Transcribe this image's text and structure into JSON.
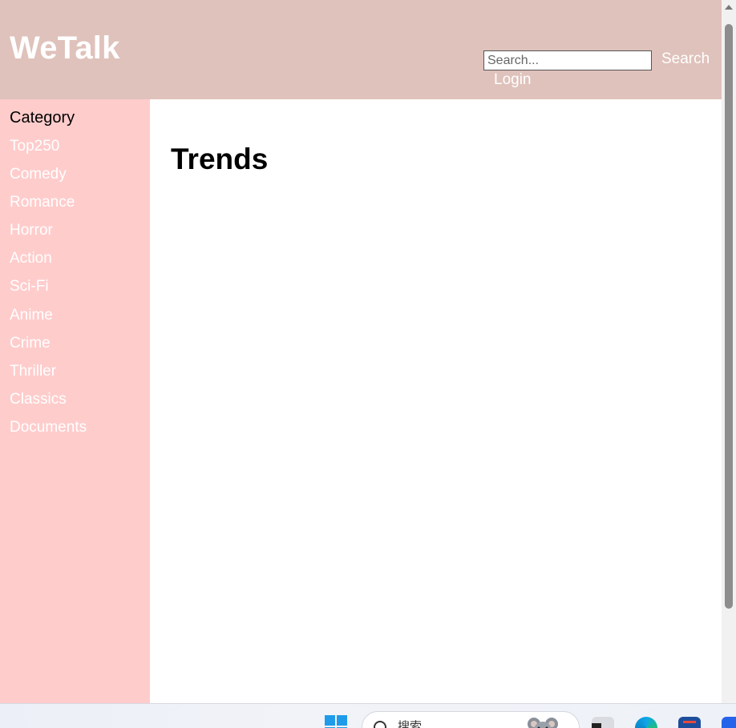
{
  "header": {
    "logo": "WeTalk",
    "search_placeholder": "Search...",
    "search_label": "Search",
    "login_label": "Login"
  },
  "sidebar": {
    "title": "Category",
    "items": [
      "Top250",
      "Comedy",
      "Romance",
      "Horror",
      "Action",
      "Sci-Fi",
      "Anime",
      "Crime",
      "Thriller",
      "Classics",
      "Documents"
    ]
  },
  "main": {
    "title": "Trends"
  },
  "taskbar": {
    "search_text": "搜索"
  },
  "colors": {
    "header_bg": "#dfc2bb",
    "sidebar_bg": "#ffcccc",
    "link_text": "#ffffff"
  }
}
